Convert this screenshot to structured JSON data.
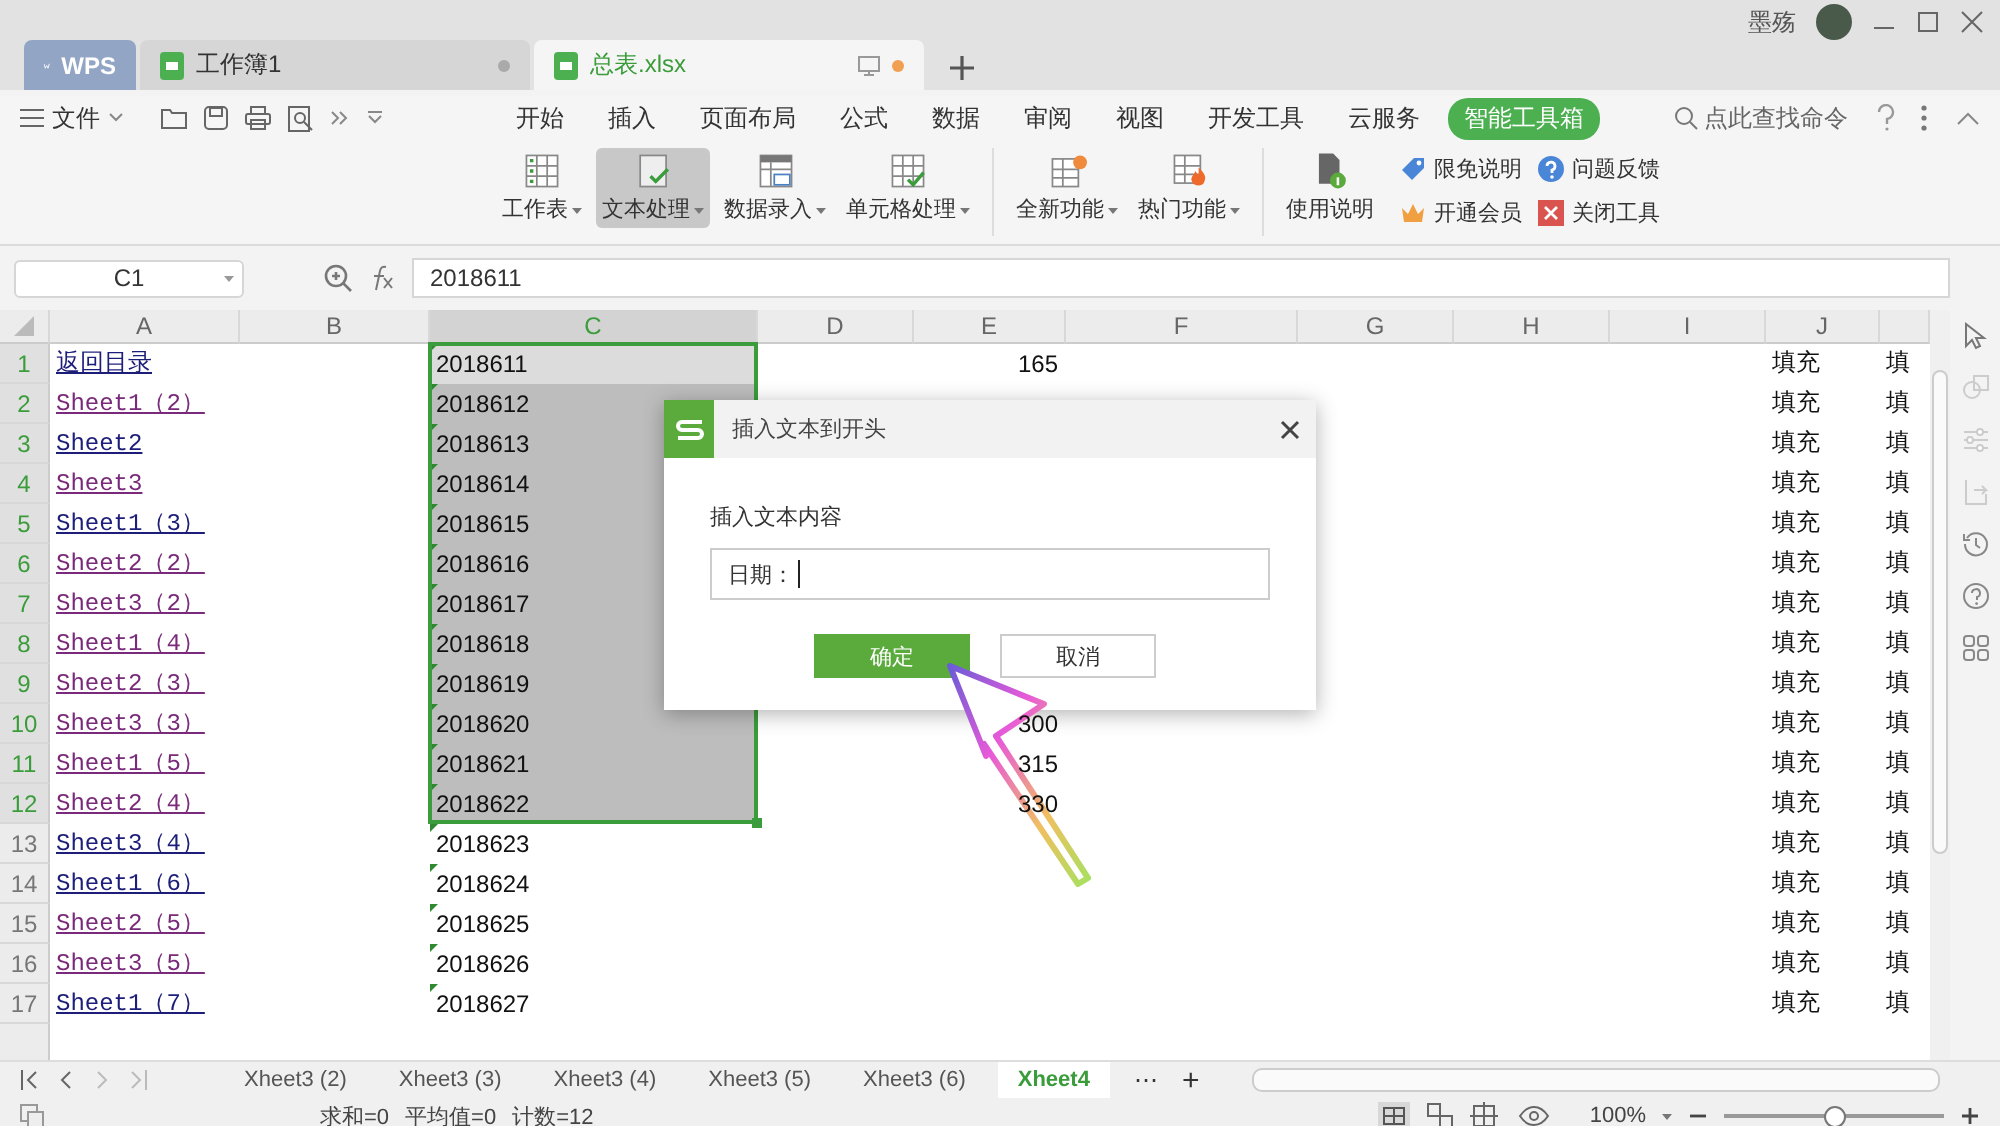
{
  "app_tabs": [
    {
      "label": "WPS",
      "kind": "home",
      "selected": false
    },
    {
      "label": "工作簿1",
      "kind": "doc",
      "selected": false
    },
    {
      "label": "总表.xlsx",
      "kind": "doc",
      "selected": true
    }
  ],
  "user": {
    "name": "墨殇"
  },
  "file_menu": {
    "label": "文件"
  },
  "ribbon_tabs": [
    {
      "label": "开始",
      "selected": false
    },
    {
      "label": "插入",
      "selected": false
    },
    {
      "label": "页面布局",
      "selected": false
    },
    {
      "label": "公式",
      "selected": false
    },
    {
      "label": "数据",
      "selected": false
    },
    {
      "label": "审阅",
      "selected": false
    },
    {
      "label": "视图",
      "selected": false
    },
    {
      "label": "开发工具",
      "selected": false
    },
    {
      "label": "云服务",
      "selected": false
    },
    {
      "label": "智能工具箱",
      "selected": true
    }
  ],
  "search": {
    "placeholder": "点此查找命令"
  },
  "ribbon_groups": [
    {
      "tools": [
        {
          "label": "工作表",
          "dropdown": true,
          "selected": false
        },
        {
          "label": "文本处理",
          "dropdown": true,
          "selected": true
        },
        {
          "label": "数据录入",
          "dropdown": true,
          "selected": false
        },
        {
          "label": "单元格处理",
          "dropdown": true,
          "selected": false
        }
      ]
    },
    {
      "tools": [
        {
          "label": "全新功能",
          "dropdown": true,
          "selected": false
        },
        {
          "label": "热门功能",
          "dropdown": true,
          "selected": false
        }
      ]
    },
    {
      "tools": [
        {
          "label": "使用说明",
          "dropdown": false,
          "selected": false
        }
      ],
      "links": [
        {
          "label": "限免说明"
        },
        {
          "label": "开通会员"
        },
        {
          "label": "问题反馈"
        },
        {
          "label": "关闭工具"
        }
      ]
    }
  ],
  "name_box": {
    "value": "C1"
  },
  "formula": {
    "value": "2018611"
  },
  "columns": [
    {
      "label": "A",
      "selected": false
    },
    {
      "label": "B",
      "selected": false
    },
    {
      "label": "C",
      "selected": true
    },
    {
      "label": "D",
      "selected": false
    },
    {
      "label": "E",
      "selected": false
    },
    {
      "label": "F",
      "selected": false
    },
    {
      "label": "G",
      "selected": false
    },
    {
      "label": "H",
      "selected": false
    },
    {
      "label": "I",
      "selected": false
    },
    {
      "label": "J",
      "selected": false
    }
  ],
  "rows": [
    {
      "number": "1",
      "link": "返回目录",
      "visited": false,
      "c": "2018611",
      "e": "165",
      "j": "填充",
      "k": "填",
      "selected": true,
      "active": true
    },
    {
      "number": "2",
      "link": "Sheet1（2）",
      "visited": true,
      "c": "2018612",
      "j": "填充",
      "k": "填",
      "selected": true,
      "active": false
    },
    {
      "number": "3",
      "link": "Sheet2",
      "visited": false,
      "c": "2018613",
      "j": "填充",
      "k": "填",
      "selected": true,
      "active": false
    },
    {
      "number": "4",
      "link": "Sheet3",
      "visited": true,
      "c": "2018614",
      "j": "填充",
      "k": "填",
      "selected": true,
      "active": false
    },
    {
      "number": "5",
      "link": "Sheet1（3）",
      "visited": false,
      "c": "2018615",
      "j": "填充",
      "k": "填",
      "selected": true,
      "active": false
    },
    {
      "number": "6",
      "link": "Sheet2（2）",
      "visited": true,
      "c": "2018616",
      "j": "填充",
      "k": "填",
      "selected": true,
      "active": false
    },
    {
      "number": "7",
      "link": "Sheet3（2）",
      "visited": true,
      "c": "2018617",
      "j": "填充",
      "k": "填",
      "selected": true,
      "active": false
    },
    {
      "number": "8",
      "link": "Sheet1（4）",
      "visited": true,
      "c": "2018618",
      "j": "填充",
      "k": "填",
      "selected": true,
      "active": false
    },
    {
      "number": "9",
      "link": "Sheet2（3）",
      "visited": true,
      "c": "2018619",
      "j": "填充",
      "k": "填",
      "selected": true,
      "active": false
    },
    {
      "number": "10",
      "link": "Sheet3（3）",
      "visited": true,
      "c": "2018620",
      "e": "300",
      "j": "填充",
      "k": "填",
      "selected": true,
      "active": false
    },
    {
      "number": "11",
      "link": "Sheet1（5）",
      "visited": true,
      "c": "2018621",
      "e": "315",
      "j": "填充",
      "k": "填",
      "selected": true,
      "active": false
    },
    {
      "number": "12",
      "link": "Sheet2（4）",
      "visited": true,
      "c": "2018622",
      "e": "330",
      "j": "填充",
      "k": "填",
      "selected": true,
      "active": false
    },
    {
      "number": "13",
      "link": "Sheet3（4）",
      "visited": false,
      "c": "2018623",
      "j": "填充",
      "k": "填",
      "selected": false,
      "active": false
    },
    {
      "number": "14",
      "link": "Sheet1（6）",
      "visited": false,
      "c": "2018624",
      "j": "填充",
      "k": "填",
      "selected": false,
      "active": false
    },
    {
      "number": "15",
      "link": "Sheet2（5）",
      "visited": true,
      "c": "2018625",
      "j": "填充",
      "k": "填",
      "selected": false,
      "active": false
    },
    {
      "number": "16",
      "link": "Sheet3（5）",
      "visited": true,
      "c": "2018626",
      "j": "填充",
      "k": "填",
      "selected": false,
      "active": false
    },
    {
      "number": "17",
      "link": "Sheet1（7）",
      "visited": false,
      "c": "2018627",
      "j": "填充",
      "k": "填",
      "selected": false,
      "active": false
    }
  ],
  "dialog": {
    "title": "插入文本到开头",
    "label": "插入文本内容",
    "value": "日期：",
    "buttons": [
      {
        "label": "确定",
        "kind": "primary"
      },
      {
        "label": "取消",
        "kind": "secondary"
      }
    ]
  },
  "sheet_tabs": [
    {
      "label": "Xheet3 (2)",
      "selected": false
    },
    {
      "label": "Xheet3 (3)",
      "selected": false
    },
    {
      "label": "Xheet3 (4)",
      "selected": false
    },
    {
      "label": "Xheet3 (5)",
      "selected": false
    },
    {
      "label": "Xheet3 (6)",
      "selected": false
    },
    {
      "label": "Xheet4",
      "selected": true
    }
  ],
  "sheet_more": "⋯",
  "sheet_add": "+",
  "status": {
    "items": [
      "求和=0",
      "平均值=0",
      "计数=12"
    ],
    "zoom": "100%",
    "level": 0.5
  }
}
